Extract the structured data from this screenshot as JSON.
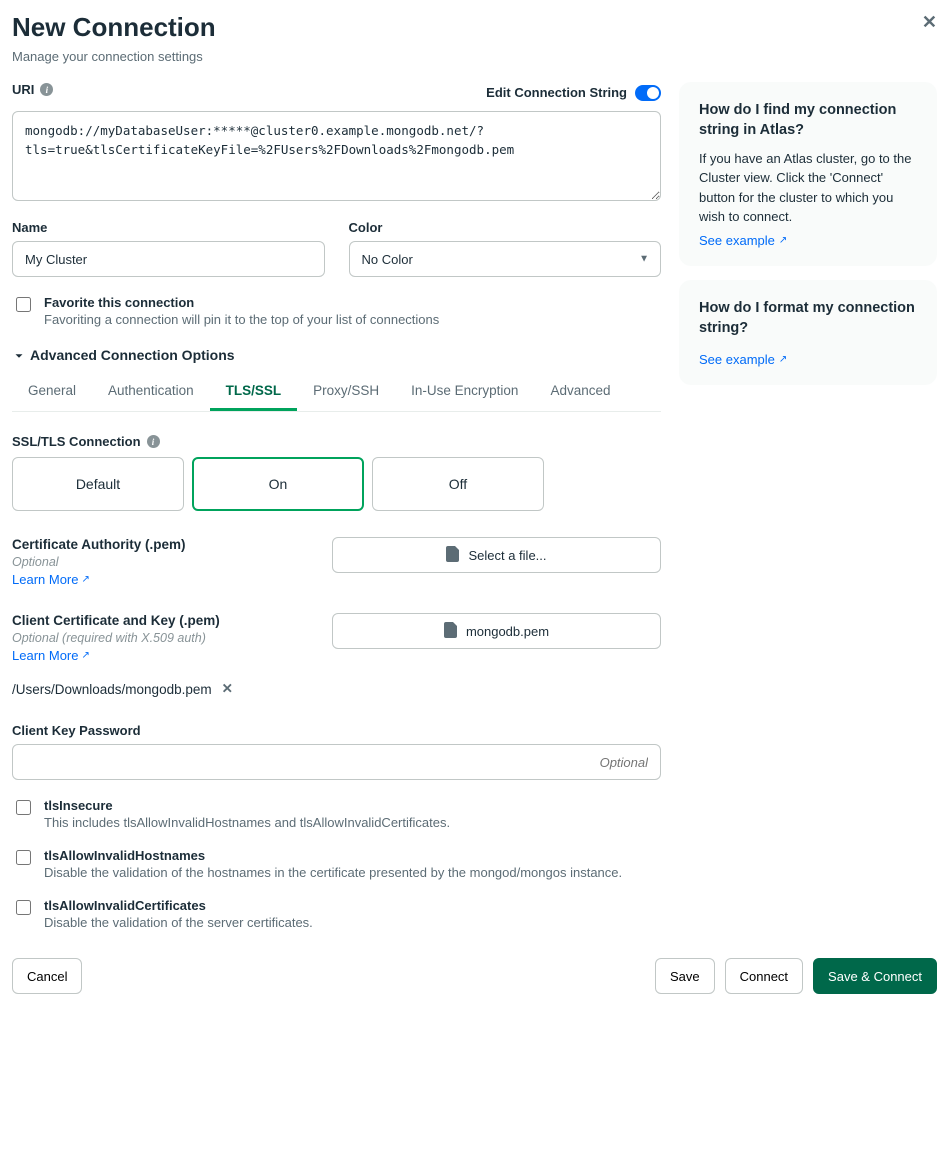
{
  "header": {
    "title": "New Connection",
    "subtitle": "Manage your connection settings"
  },
  "uri": {
    "label": "URI",
    "toggle_label": "Edit Connection String",
    "value": "mongodb://myDatabaseUser:*****@cluster0.example.mongodb.net/?tls=true&tlsCertificateKeyFile=%2FUsers%2FDownloads%2Fmongodb.pem"
  },
  "name": {
    "label": "Name",
    "value": "My Cluster"
  },
  "color": {
    "label": "Color",
    "selected": "No Color"
  },
  "favorite": {
    "title": "Favorite this connection",
    "desc": "Favoriting a connection will pin it to the top of your list of connections"
  },
  "advanced_label": "Advanced Connection Options",
  "tabs": {
    "general": "General",
    "auth": "Authentication",
    "tls": "TLS/SSL",
    "proxy": "Proxy/SSH",
    "encryption": "In-Use Encryption",
    "advanced": "Advanced"
  },
  "tls": {
    "label": "SSL/TLS Connection",
    "default": "Default",
    "on": "On",
    "off": "Off"
  },
  "ca": {
    "label": "Certificate Authority (.pem)",
    "optional": "Optional",
    "learn": "Learn More",
    "select_btn": "Select a file..."
  },
  "client_cert": {
    "label": "Client Certificate and Key (.pem)",
    "optional": "Optional (required with X.509 auth)",
    "learn": "Learn More",
    "file_btn": "mongodb.pem",
    "path": "/Users/Downloads/mongodb.pem"
  },
  "pw": {
    "label": "Client Key Password",
    "placeholder": "Optional"
  },
  "tls_insecure": {
    "title": "tlsInsecure",
    "desc": "This includes tlsAllowInvalidHostnames and tlsAllowInvalidCertificates."
  },
  "tls_hostnames": {
    "title": "tlsAllowInvalidHostnames",
    "desc": "Disable the validation of the hostnames in the certificate presented by the mongod/mongos instance."
  },
  "tls_certs": {
    "title": "tlsAllowInvalidCertificates",
    "desc": "Disable the validation of the server certificates."
  },
  "side1": {
    "title": "How do I find my connection string in Atlas?",
    "body": "If you have an Atlas cluster, go to the Cluster view. Click the 'Connect' button for the cluster to which you wish to connect.",
    "link": "See example"
  },
  "side2": {
    "title": "How do I format my connection string?",
    "link": "See example"
  },
  "footer": {
    "cancel": "Cancel",
    "save": "Save",
    "connect": "Connect",
    "save_connect": "Save & Connect"
  }
}
